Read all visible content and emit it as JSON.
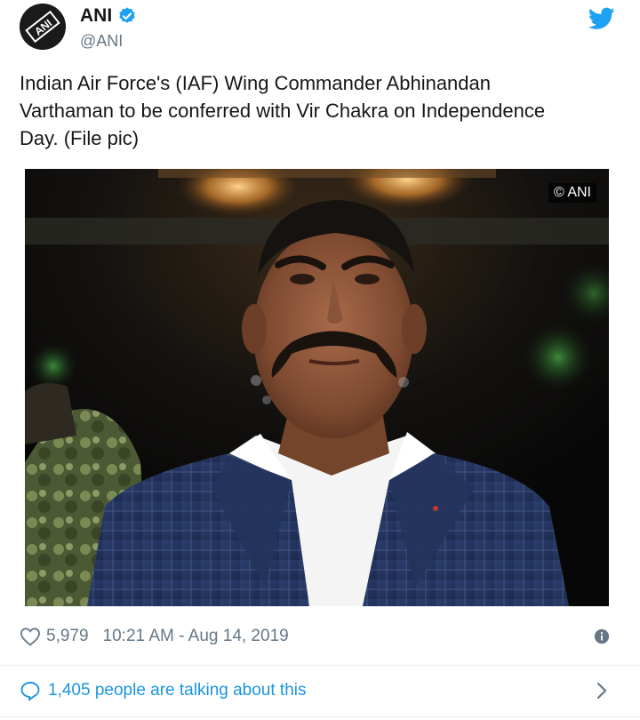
{
  "account": {
    "display_name": "ANI",
    "handle": "@ANI",
    "avatar_logo_text": "ANI",
    "verified_icon": "verified-badge-icon"
  },
  "brand_icon": "twitter-bird-icon",
  "tweet": {
    "text_line1": "Indian Air Force's (IAF) Wing Commander Abhinandan",
    "text_line2": "Varthaman to be conferred with Vir Chakra on Independence",
    "text_line3": "Day. (File pic)"
  },
  "media": {
    "watermark": "© ANI"
  },
  "meta": {
    "likes": "5,979",
    "timestamp": "10:21 AM - Aug 14, 2019",
    "info_icon": "info-icon"
  },
  "conversation": {
    "text": "1,405 people are talking about this",
    "icon": "speech-bubble-icon",
    "chevron": "chevron-right-icon"
  },
  "colors": {
    "link_blue": "#1b95e0",
    "twitter_blue": "#1da1f2",
    "secondary_text": "#657786",
    "primary_text": "#14171a",
    "divider": "#e6ecf0"
  }
}
